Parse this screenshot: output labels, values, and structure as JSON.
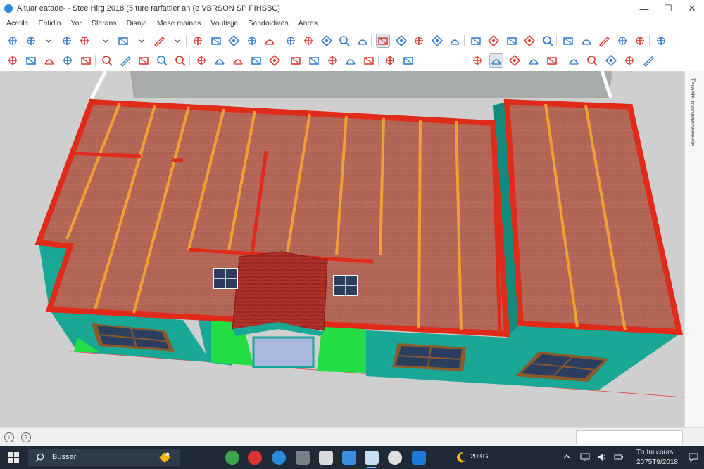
{
  "window": {
    "title": "Altuar  eatade-  - Stee Hirg 2018 (5 ture rarfattier an (e VBRSON  SP PIHSBC)",
    "minimize_glyph": "—",
    "maximize_glyph": "☐",
    "close_glyph": "✕"
  },
  "menu": [
    "Acatile",
    "Entidin",
    "Yor",
    "Slerans",
    "Disnja",
    "Mese mainas",
    "Voutisjje",
    "Sandoidives",
    "Anres"
  ],
  "toolbar_row1_icons": [
    "search-icon",
    "select-arrow-icon",
    "dropdown-arrow-icon",
    "eraser-icon",
    "pencil-icon",
    "dropdown-arrow-icon",
    "line-tool-icon",
    "dropdown-arrow-icon",
    "rectangle-tool-icon",
    "dropdown-arrow-icon",
    "paint-bucket-icon",
    "push-pull-icon",
    "move-icon",
    "rotate-icon",
    "scale-icon",
    "offset-icon",
    "tape-measure-icon",
    "protractor-icon",
    "section-plane-icon",
    "orbit-icon",
    "pan-icon",
    "zoom-icon",
    "zoom-extents-icon",
    "walk-icon",
    "look-around-icon",
    "position-camera-icon",
    "axes-icon",
    "dimension-icon",
    "text-icon",
    "3d-text-icon",
    "component-icon",
    "group-icon",
    "outliner-icon",
    "layers-icon",
    "styles-icon",
    "scenes-icon"
  ],
  "toolbar_row2_icons": [
    "pencil-icon",
    "follow-me-icon",
    "shape-icon",
    "circle-icon",
    "arc-icon",
    "polygon-icon",
    "freehand-icon",
    "intersect-icon",
    "sandbox-icon",
    "contour-icon",
    "smoove-icon",
    "stamp-icon",
    "drape-icon",
    "flip-edge-icon",
    "add-detail-icon",
    "warehouse-icon",
    "extension-icon",
    "geo-location-icon",
    "solar-icon",
    "sun-icon",
    "shadow-icon",
    "fog-icon"
  ],
  "toolbar_row2_right_icons": [
    "camera-icon",
    "orbit-icon",
    "zoom-icon",
    "zoom-window-icon",
    "pan-icon",
    "paint-icon",
    "previous-view-icon",
    "axes-icon",
    "export-icon",
    "settings-icon"
  ],
  "right_tray": {
    "label": "Teraete monaaeoeeeeie"
  },
  "taskbar": {
    "search_placeholder": "Bussar",
    "weather": "20KG",
    "time": "Trutui cours",
    "date": "2075T9/2018"
  },
  "colors": {
    "roof_brick": "#b86a5a",
    "roof_edge": "#e02a1a",
    "rafter": "#f0a030",
    "wall": "#1aa896",
    "ground_green": "#22dd44",
    "tile_roof": "#b0302a",
    "viewport_bg": "#cfcfcf",
    "toolbar_accent_red": "#d9352a",
    "toolbar_accent_blue": "#2a78c8"
  }
}
